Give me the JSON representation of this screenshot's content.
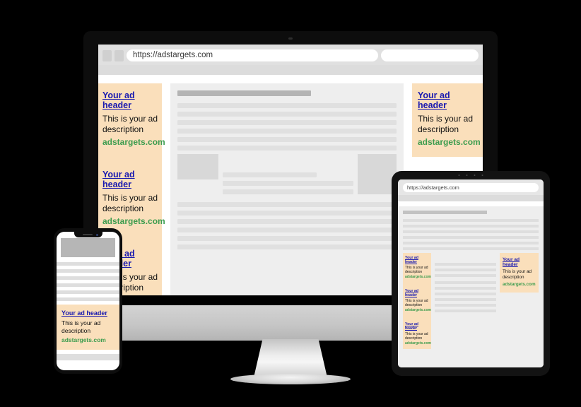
{
  "ad": {
    "header": "Your ad header",
    "description_line1": "This is your ad",
    "description_line2": "description",
    "url": "adstargets.com"
  },
  "browser": {
    "url_value": "https://adstargets.com",
    "url_placeholder": "https://adstargets.com",
    "search_value": ""
  },
  "tablet": {
    "url_value": "https://adstargets.com"
  },
  "colors": {
    "ad_background": "#fadfbb",
    "ad_header_link": "#1a1ab0",
    "ad_url_green": "#3c9c4e",
    "page_background": "#000000",
    "device_bezel": "#0d0d0d",
    "content_placeholder": "#dedede",
    "title_placeholder": "#b4b4b4"
  },
  "devices": {
    "monitor_label": "desktop-monitor",
    "phone_label": "smartphone",
    "tablet_label": "tablet"
  }
}
